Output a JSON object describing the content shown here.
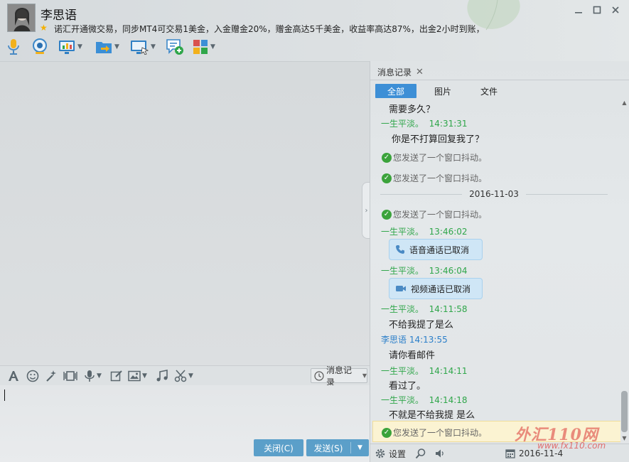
{
  "header": {
    "username": "李思语",
    "signature": "诺汇开通微交易，同步MT4可交易1美金，入金赠金20%，赠金高达5千美金，收益率高达87%，出金2小时到账，",
    "window_controls": [
      "minimize-icon",
      "maximize-icon",
      "close-icon"
    ]
  },
  "toolbar": {
    "icons": [
      "microphone-icon",
      "camera-icon",
      "screen-share-icon",
      "file-transfer-icon",
      "remote-desktop-icon",
      "new-chat-icon",
      "apps-icon"
    ]
  },
  "input_toolbar": {
    "history_label": "消息记录"
  },
  "buttons": {
    "close_label": "关闭(C)",
    "send_label": "发送(S)"
  },
  "panel": {
    "tab_label": "消息记录",
    "filters": [
      "全部",
      "图片",
      "文件"
    ],
    "active_filter": "全部",
    "settings_label": "设置",
    "date_label": "2016-11-4"
  },
  "messages": [
    {
      "kind": "text",
      "text": "需要多久？"
    },
    {
      "kind": "header",
      "sender": "一生平淡。",
      "time": "14:31:31"
    },
    {
      "kind": "text",
      "text": "你是不打算回复我了？"
    },
    {
      "kind": "system",
      "text": "您发送了一个窗口抖动。"
    },
    {
      "kind": "system",
      "text": "您发送了一个窗口抖动。"
    },
    {
      "kind": "date",
      "text": "2016-11-03"
    },
    {
      "kind": "system",
      "text": "您发送了一个窗口抖动。"
    },
    {
      "kind": "header",
      "sender": "一生平淡。",
      "time": "13:46:02"
    },
    {
      "kind": "call",
      "text": "语音通话已取消"
    },
    {
      "kind": "header",
      "sender": "一生平淡。",
      "time": "13:46:04"
    },
    {
      "kind": "call",
      "text": "视频通话已取消"
    },
    {
      "kind": "header",
      "sender": "一生平淡。",
      "time": "14:11:58"
    },
    {
      "kind": "text",
      "text": "不给我提了是么"
    },
    {
      "kind": "header",
      "sender": "李思语",
      "time": "14:13:55"
    },
    {
      "kind": "text",
      "text": "请你看邮件"
    },
    {
      "kind": "header",
      "sender": "一生平淡。",
      "time": "14:14:11"
    },
    {
      "kind": "text",
      "text": "看过了。"
    },
    {
      "kind": "header",
      "sender": "一生平淡。",
      "time": "14:14:18"
    },
    {
      "kind": "text",
      "text": "不就是不给我提 是么"
    },
    {
      "kind": "system",
      "text": "您发送了一个窗口抖动。"
    }
  ],
  "watermark": {
    "title": "外汇110网",
    "url": "www.fx110.com"
  },
  "colors": {
    "accent": "#3d8fd6",
    "button": "#5b9fc9",
    "sender_self": "#2a7ec9",
    "sender_other": "#2fa64a"
  }
}
